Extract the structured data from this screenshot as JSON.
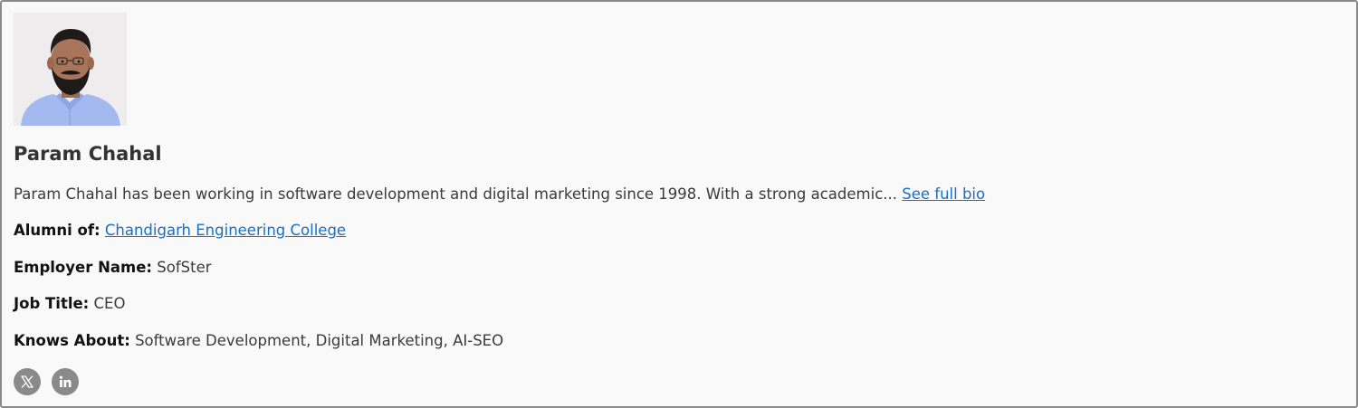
{
  "profile": {
    "name": "Param Chahal",
    "photo_alt": "Param Chahal",
    "bio_excerpt": "Param Chahal has been working in software development and digital marketing since 1998. With a strong academic...",
    "bio_link_text": "See full bio",
    "alumni_label": "Alumni of:",
    "alumni_value": "Chandigarh Engineering College",
    "employer_label": "Employer Name:",
    "employer_value": "SofSter",
    "job_label": "Job Title:",
    "job_value": "CEO",
    "knows_label": "Knows About:",
    "knows_value": "Software Development, Digital Marketing, AI-SEO"
  },
  "socials": [
    {
      "icon": "x-twitter-icon"
    },
    {
      "icon": "linkedin-icon"
    }
  ],
  "colors": {
    "card_background": "#f9f9f9",
    "card_border": "#8a8a8a",
    "link": "#1a6fc2",
    "social_icon_bg": "#8a8a8a",
    "photo_background": "#eeeeee",
    "shirt": "#9fb8f0"
  }
}
